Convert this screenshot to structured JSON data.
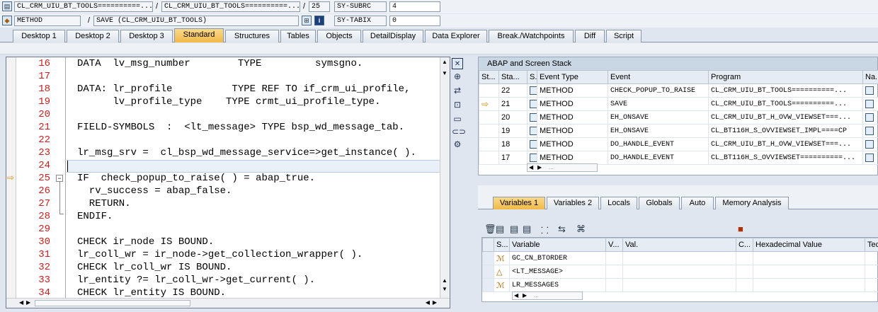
{
  "header": {
    "row1": {
      "program": "CL_CRM_UIU_BT_TOOLS==========...",
      "include": "CL_CRM_UIU_BT_TOOLS==========...",
      "line": "25",
      "sysfield": "SY-SUBRC",
      "sysvalue": "4"
    },
    "row2": {
      "type": "METHOD",
      "event": "SAVE (CL_CRM_UIU_BT_TOOLS)",
      "sysfield": "SY-TABIX",
      "sysvalue": "0"
    },
    "sep": "/"
  },
  "tabs": [
    "Desktop 1",
    "Desktop 2",
    "Desktop 3",
    "Standard",
    "Structures",
    "Tables",
    "Objects",
    "DetailDisplay",
    "Data Explorer",
    "Break./Watchpoints",
    "Diff",
    "Script"
  ],
  "active_tab": "Standard",
  "code": {
    "lines": [
      {
        "n": "16",
        "t": "DATA  lv_msg_number        TYPE         symsgno."
      },
      {
        "n": "17",
        "t": ""
      },
      {
        "n": "18",
        "t": "DATA: lr_profile          TYPE REF TO if_crm_ui_profile,"
      },
      {
        "n": "19",
        "t": "      lv_profile_type    TYPE crmt_ui_profile_type."
      },
      {
        "n": "20",
        "t": ""
      },
      {
        "n": "21",
        "t": "FIELD-SYMBOLS  :  <lt_message> TYPE bsp_wd_message_tab."
      },
      {
        "n": "22",
        "t": ""
      },
      {
        "n": "23",
        "t": "lr_msg_srv =  cl_bsp_wd_message_service=>get_instance( )."
      },
      {
        "n": "24",
        "t": ""
      },
      {
        "n": "25",
        "t": "IF  check_popup_to_raise( ) = abap_true."
      },
      {
        "n": "26",
        "t": "  rv_success = abap_false."
      },
      {
        "n": "27",
        "t": "  RETURN."
      },
      {
        "n": "28",
        "t": "ENDIF."
      },
      {
        "n": "29",
        "t": ""
      },
      {
        "n": "30",
        "t": "CHECK ir_node IS BOUND."
      },
      {
        "n": "31",
        "t": "lr_coll_wr = ir_node->get_collection_wrapper( )."
      },
      {
        "n": "32",
        "t": "CHECK lr_coll_wr IS BOUND."
      },
      {
        "n": "33",
        "t": "lr_entity ?= lr_coll_wr->get_current( )."
      },
      {
        "n": "34",
        "t": "CHECK lr_entity IS BOUND."
      }
    ]
  },
  "stack": {
    "title": "ABAP and Screen Stack",
    "columns": [
      "St...",
      "Sta...",
      "S...",
      "Event Type",
      "Event",
      "Program",
      "Na..."
    ],
    "rows": [
      {
        "level": "22",
        "type": "METHOD",
        "event": "CHECK_POPUP_TO_RAISE",
        "program": "CL_CRM_UIU_BT_TOOLS==========..."
      },
      {
        "level": "21",
        "type": "METHOD",
        "event": "SAVE",
        "program": "CL_CRM_UIU_BT_TOOLS==========..."
      },
      {
        "level": "20",
        "type": "METHOD",
        "event": "EH_ONSAVE",
        "program": "CL_CRM_UIU_BT_H_OVW_VIEWSET===..."
      },
      {
        "level": "19",
        "type": "METHOD",
        "event": "EH_ONSAVE",
        "program": "CL_BT116H_S_OVVIEWSET_IMPL====CP"
      },
      {
        "level": "18",
        "type": "METHOD",
        "event": "DO_HANDLE_EVENT",
        "program": "CL_CRM_UIU_BT_H_OVW_VIEWSET===..."
      },
      {
        "level": "17",
        "type": "METHOD",
        "event": "DO_HANDLE_EVENT",
        "program": "CL_BT116H_S_OVVIEWSET==========..."
      }
    ]
  },
  "var_tabs": [
    "Variables 1",
    "Variables 2",
    "Locals",
    "Globals",
    "Auto",
    "Memory Analysis"
  ],
  "variables": {
    "columns": [
      "S...",
      "Variable",
      "V...",
      "Val.",
      "C...",
      "Hexadecimal Value",
      "Tec"
    ],
    "rows": [
      {
        "name": "GC_CN_BTORDER"
      },
      {
        "name": "<LT_MESSAGE>"
      },
      {
        "name": "LR_MESSAGES"
      }
    ]
  },
  "scroll_dots": "..."
}
